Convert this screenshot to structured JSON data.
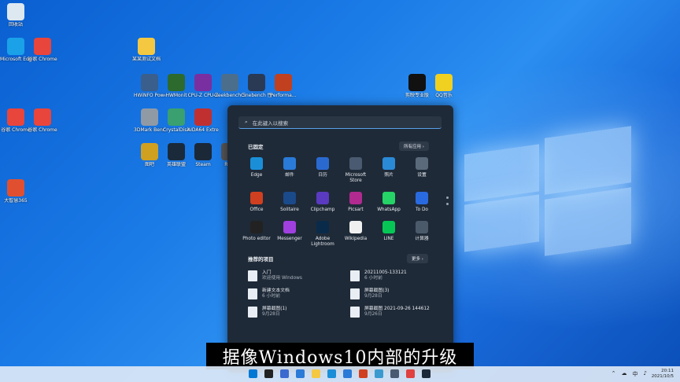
{
  "desktop": {
    "icons": [
      {
        "label": "回收站",
        "icon": "recycle-bin-icon",
        "color": "#dde8f0"
      },
      {
        "label": "Microsoft Edge",
        "icon": "edge-icon",
        "color": "#1aa1e8"
      },
      {
        "label": "谷歌 Chrome",
        "icon": "chrome-icon",
        "color": "#e8453c"
      },
      {
        "label": "某某测试文档",
        "icon": "folder-icon",
        "color": "#f5c842"
      },
      {
        "label": "HWiNFO Power",
        "icon": "hwinfo-icon",
        "color": "#3a5f8c"
      },
      {
        "label": "HWMonit",
        "icon": "hwmonitor-icon",
        "color": "#2d6a2d"
      },
      {
        "label": "CPU-Z CPU-Z",
        "icon": "cpuz-icon",
        "color": "#7a2fa0"
      },
      {
        "label": "Geekbench 5",
        "icon": "geekbench-icon",
        "color": "#4b6e8c"
      },
      {
        "label": "Cinebench 性能测试",
        "icon": "cinebench-icon",
        "color": "#2a3a55"
      },
      {
        "label": "Performa...",
        "icon": "performance-icon",
        "color": "#c04020"
      },
      {
        "label": "剪映专业版",
        "icon": "capcut-icon",
        "color": "#111111"
      },
      {
        "label": "QQ音乐",
        "icon": "qqmusic-icon",
        "color": "#f0d020"
      },
      {
        "label": "谷歌 Chrome",
        "icon": "chrome-icon",
        "color": "#e8453c"
      },
      {
        "label": "谷歌 Chrome",
        "icon": "chrome-icon",
        "color": "#e8453c"
      },
      {
        "label": "3DMark Benchmark",
        "icon": "3dmark-icon",
        "color": "#909aa5"
      },
      {
        "label": "CrystalDisk",
        "icon": "crystaldisk-icon",
        "color": "#3aa070"
      },
      {
        "label": "AIDA64 Extreme",
        "icon": "aida64-icon",
        "color": "#c03030"
      },
      {
        "label": "大智慧365",
        "icon": "stock-app-icon",
        "color": "#e05030"
      },
      {
        "label": "图吧",
        "icon": "tuba-icon",
        "color": "#d0a020"
      },
      {
        "label": "英雄联盟",
        "icon": "lol-icon",
        "color": "#1a2a3a"
      },
      {
        "label": "Steam",
        "icon": "steam-icon",
        "color": "#1b2838"
      },
      {
        "label": "Reta",
        "icon": "app-icon",
        "color": "#555555"
      }
    ]
  },
  "start_menu": {
    "search_placeholder": "在此键入以搜索",
    "pinned_title": "已固定",
    "all_apps_label": "所有应用  ›",
    "recommended_title": "推荐的项目",
    "more_label": "更多  ›",
    "apps": [
      {
        "label": "Edge",
        "icon": "edge-icon",
        "color": "#1a8fd8"
      },
      {
        "label": "邮件",
        "icon": "mail-icon",
        "color": "#2a7ad8"
      },
      {
        "label": "日历",
        "icon": "calendar-icon",
        "color": "#2a6ad0"
      },
      {
        "label": "Microsoft Store",
        "icon": "store-icon",
        "color": "#4a5a70"
      },
      {
        "label": "照片",
        "icon": "photos-icon",
        "color": "#2a8ad8"
      },
      {
        "label": "设置",
        "icon": "settings-icon",
        "color": "#5a6a7a"
      },
      {
        "label": "Office",
        "icon": "office-icon",
        "color": "#d04020"
      },
      {
        "label": "Solitaire",
        "icon": "solitaire-icon",
        "color": "#1a4a8a"
      },
      {
        "label": "Clipchamp",
        "icon": "clipchamp-icon",
        "color": "#5a3ac0"
      },
      {
        "label": "Picsart",
        "icon": "picsart-icon",
        "color": "#b02a90"
      },
      {
        "label": "WhatsApp",
        "icon": "whatsapp-icon",
        "color": "#25d366"
      },
      {
        "label": "To Do",
        "icon": "todo-icon",
        "color": "#2a6ae0"
      },
      {
        "label": "Photo editor",
        "icon": "photo-editor-icon",
        "color": "#222222"
      },
      {
        "label": "Messenger",
        "icon": "messenger-icon",
        "color": "#a040e0"
      },
      {
        "label": "Adobe Lightroom",
        "icon": "lightroom-icon",
        "color": "#0a2a4a"
      },
      {
        "label": "Wikipedia",
        "icon": "wikipedia-icon",
        "color": "#f0f0f0"
      },
      {
        "label": "LINE",
        "icon": "line-icon",
        "color": "#06c755"
      },
      {
        "label": "计算器",
        "icon": "calculator-icon",
        "color": "#4a5a6a"
      }
    ],
    "recommended": [
      {
        "name": "入门",
        "sub": "欢迎使用 Windows"
      },
      {
        "name": "20211005-133121",
        "sub": "6 小时前"
      },
      {
        "name": "新建文本文档",
        "sub": "6 小时前"
      },
      {
        "name": "屏幕截图(3)",
        "sub": "9月28日"
      },
      {
        "name": "屏幕截图(1)",
        "sub": "9月28日"
      },
      {
        "name": "屏幕截图 2021-09-26 144612",
        "sub": "9月26日"
      }
    ]
  },
  "subtitle": "据像Windows10内部的升级",
  "taskbar": {
    "time": "20:11",
    "date": "2021/10/5",
    "ime": "中",
    "apps": [
      "#0078d4",
      "#222",
      "#3a6ad0",
      "#2a7ad8",
      "#f5c842",
      "#1a8fd8",
      "#2a7ad8",
      "#d04020",
      "#3a9ad0",
      "#4a5a70",
      "#e04040",
      "#1b2838"
    ]
  }
}
